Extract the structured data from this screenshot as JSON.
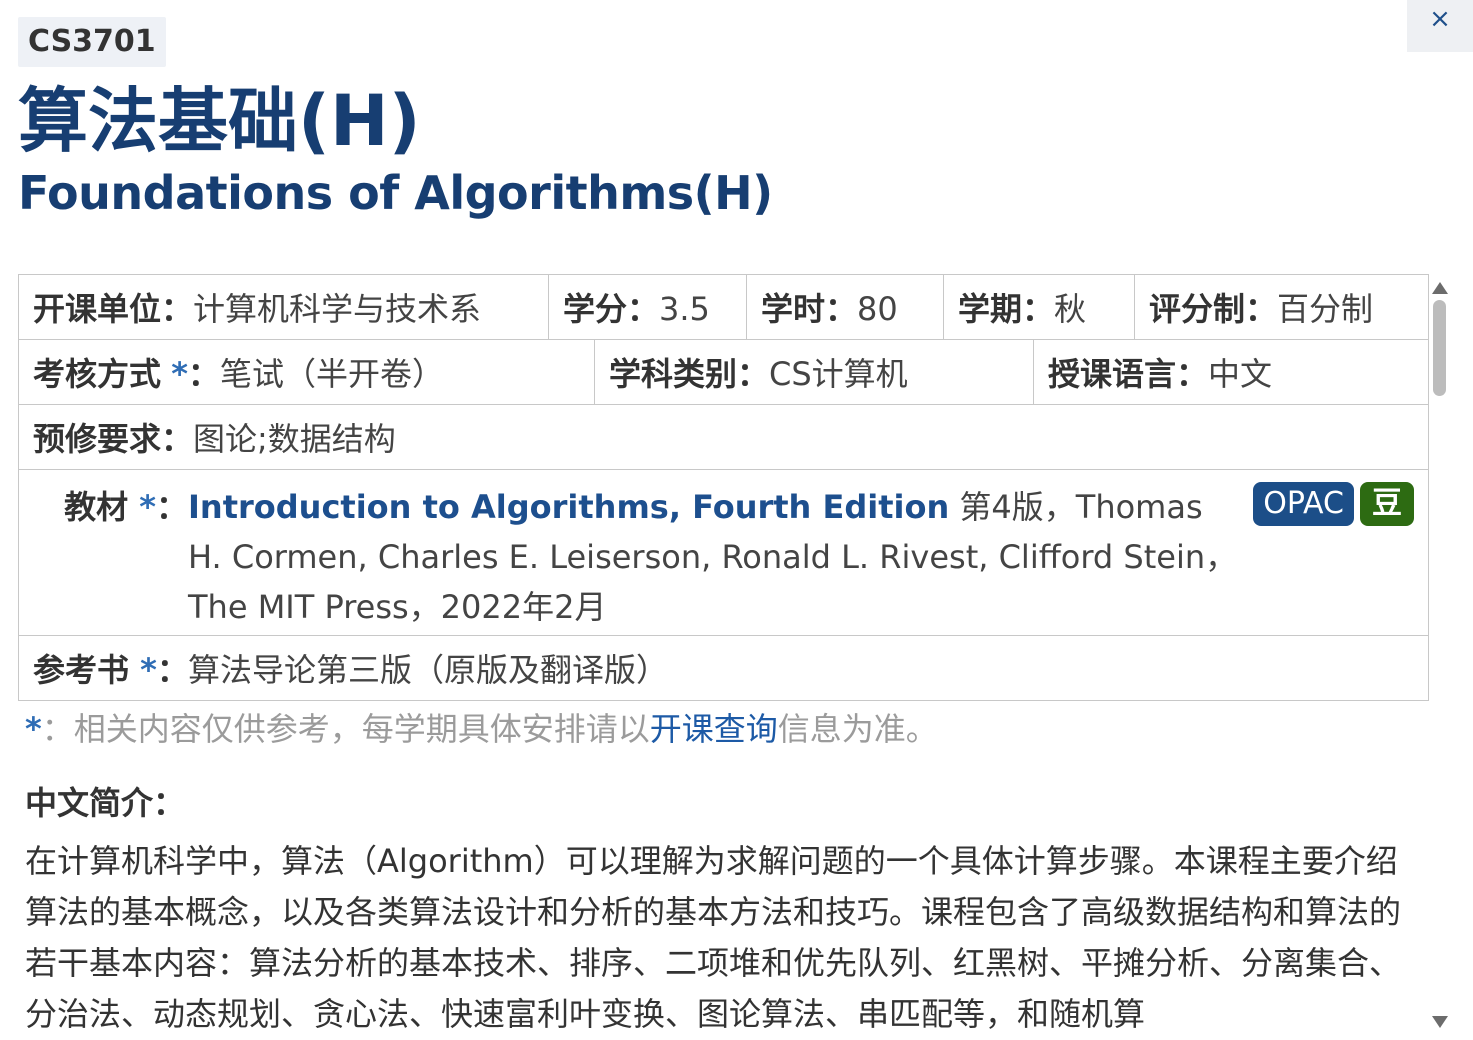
{
  "course_code": "CS3701",
  "close_symbol": "×",
  "title_zh": "算法基础(H)",
  "title_en": "Foundations of Algorithms(H)",
  "info": {
    "dept_label": "开课单位：",
    "dept_value": "计算机科学与技术系",
    "credit_label": "学分：",
    "credit_value": "3.5",
    "hours_label": "学时：",
    "hours_value": "80",
    "term_label": "学期：",
    "term_value": "秋",
    "grading_label": "评分制：",
    "grading_value": "百分制",
    "exam_label": "考核方式",
    "exam_value": "笔试（半开卷）",
    "category_label": "学科类别：",
    "category_value": "CS计算机",
    "language_label": "授课语言：",
    "language_value": "中文",
    "prereq_label": "预修要求：",
    "prereq_value": "图论;数据结构",
    "textbook_label": "教材",
    "textbook_title": "Introduction to Algorithms, Fourth Edition",
    "textbook_detail": " 第4版，Thomas H. Cormen, Charles E. Leiserson, Ronald L. Rivest, Clifford Stein， The MIT Press，2022年2月",
    "opac_label": "OPAC",
    "douban_label": "豆",
    "reference_label": "参考书",
    "reference_value": "算法导论第三版（原版及翻译版）",
    "star": "*",
    "colon": "："
  },
  "note": {
    "star": "*",
    "text_before": "：相关内容仅供参考，每学期具体安排请以",
    "link": "开课查询",
    "text_after": "信息为准。"
  },
  "intro": {
    "heading": "中文简介：",
    "text": "在计算机科学中，算法（Algorithm）可以理解为求解问题的一个具体计算步骤。本课程主要介绍算法的基本概念，以及各类算法设计和分析的基本方法和技巧。课程包含了高级数据结构和算法的若干基本内容：算法分析的基本技术、排序、二项堆和优先队列、红黑树、平摊分析、分离集合、分治法、动态规划、贪心法、快速富利叶变换、图论算法、串匹配等，和随机算"
  },
  "colors": {
    "title": "#173e72",
    "link": "#1d4f8e",
    "opac_bg": "#1c4e88",
    "douban_bg": "#2d6b12",
    "star": "#2f6db5"
  }
}
